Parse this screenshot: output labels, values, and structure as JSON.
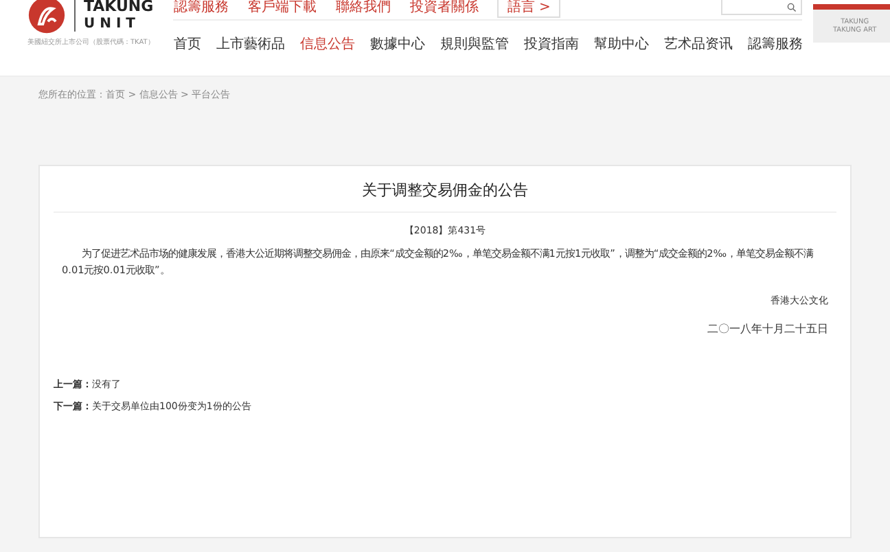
{
  "logo": {
    "name": "TAKUNG",
    "sub": "U N I T",
    "tagline": "美國紐交所上市公司（股票代碼：TKAT）"
  },
  "top_links": [
    "認籌服務",
    "客戶端下載",
    "聯絡我們",
    "投資者關係"
  ],
  "language": "語言 >",
  "nav": [
    {
      "label": "首页",
      "selected": false
    },
    {
      "label": "上市藝術品",
      "selected": false
    },
    {
      "label": "信息公告",
      "selected": true
    },
    {
      "label": "數據中心",
      "selected": false
    },
    {
      "label": "規則與監管",
      "selected": false
    },
    {
      "label": "投資指南",
      "selected": false
    },
    {
      "label": "幫助中心",
      "selected": false
    },
    {
      "label": "艺术品资讯",
      "selected": false
    },
    {
      "label": "認籌服務",
      "selected": false
    }
  ],
  "side_box": [
    "TAKUNG",
    "TAKUNG ART"
  ],
  "breadcrumb": "您所在的位置：首页 > 信息公告 > 平台公告",
  "article": {
    "title": "关于调整交易佣金的公告",
    "number": "【2018】第431号",
    "body": "为了促进艺术品市场的健康发展，香港大公近期将调整交易佣金，由原来“成交金额的2‰，单笔交易金额不满1元按1元收取”，调整为“成交金额的2‰，单笔交易金额不满0.01元按0.01元收取”。",
    "signature": "香港大公文化",
    "date": "二〇一八年十月二十五日"
  },
  "pager": [
    {
      "label": "上一篇：",
      "text": "没有了"
    },
    {
      "label": "下一篇：",
      "text": "关于交易单位由100份变为1份的公告"
    }
  ]
}
